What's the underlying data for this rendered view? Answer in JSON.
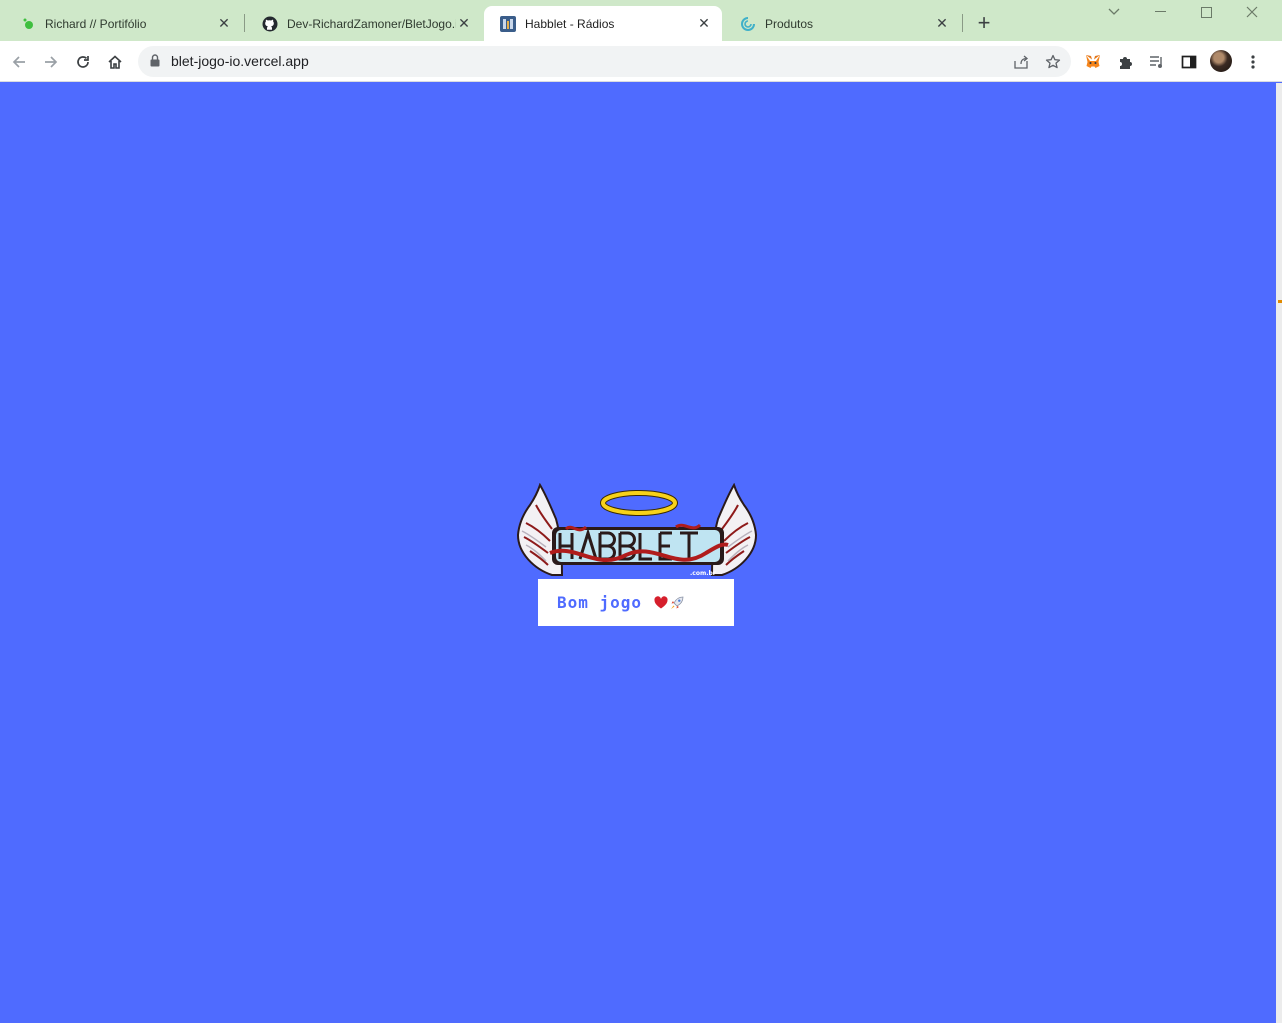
{
  "browser": {
    "tabs": [
      {
        "title": "Richard // Portifólio",
        "favicon": "green-dot-icon",
        "active": false
      },
      {
        "title": "Dev-RichardZamoner/BletJogo.io",
        "favicon": "github-icon",
        "active": false
      },
      {
        "title": "Habblet - Rádios",
        "favicon": "habblet-icon",
        "active": true
      },
      {
        "title": "Produtos",
        "favicon": "swirl-icon",
        "active": false
      }
    ],
    "address": "blet-jogo-io.vercel.app",
    "extensions": [
      "metamask-fox-icon",
      "puzzle-icon",
      "media-queue-icon",
      "sidepanel-icon"
    ]
  },
  "page": {
    "background_color": "#4f6bff",
    "logo": {
      "text": "HABBLET",
      "subtext": ".com.br"
    },
    "message": "Bom jogo",
    "emoji": [
      "heart-icon",
      "rocket-icon"
    ]
  }
}
